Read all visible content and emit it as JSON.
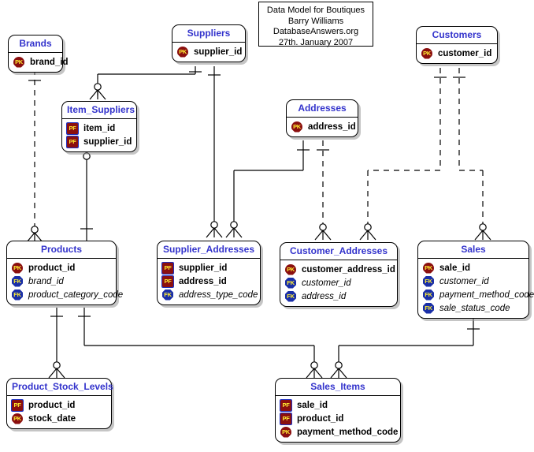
{
  "diagram": {
    "title_block": {
      "lines": [
        "Data Model for Boutiques",
        "Barry Williams",
        "DatabaseAnswers.org",
        "27th. January 2007"
      ]
    },
    "colors": {
      "entity_title": "#3333cc",
      "pk_badge": "#8b0f0f",
      "fk_badge": "#1a2fa8",
      "badge_text": "#ffee33",
      "line": "#000000",
      "background": "#ffffff"
    },
    "entities": [
      {
        "id": "brands",
        "name": "Brands",
        "attributes": [
          {
            "key": "PK",
            "name": "brand_id"
          }
        ]
      },
      {
        "id": "suppliers",
        "name": "Suppliers",
        "attributes": [
          {
            "key": "PK",
            "name": "supplier_id"
          }
        ]
      },
      {
        "id": "customers",
        "name": "Customers",
        "attributes": [
          {
            "key": "PK",
            "name": "customer_id"
          }
        ]
      },
      {
        "id": "item_suppliers",
        "name": "Item_Suppliers",
        "attributes": [
          {
            "key": "PF",
            "name": "item_id"
          },
          {
            "key": "PF",
            "name": "supplier_id"
          }
        ]
      },
      {
        "id": "addresses",
        "name": "Addresses",
        "attributes": [
          {
            "key": "PK",
            "name": "address_id"
          }
        ]
      },
      {
        "id": "products",
        "name": "Products",
        "attributes": [
          {
            "key": "PK",
            "name": "product_id"
          },
          {
            "key": "FK",
            "name": "brand_id"
          },
          {
            "key": "FK",
            "name": "product_category_code"
          }
        ]
      },
      {
        "id": "supplier_addresses",
        "name": "Supplier_Addresses",
        "attributes": [
          {
            "key": "PF",
            "name": "supplier_id"
          },
          {
            "key": "PF",
            "name": "address_id"
          },
          {
            "key": "FK",
            "name": "address_type_code"
          }
        ]
      },
      {
        "id": "customer_addresses",
        "name": "Customer_Addresses",
        "attributes": [
          {
            "key": "PK",
            "name": "customer_address_id"
          },
          {
            "key": "FK",
            "name": "customer_id"
          },
          {
            "key": "FK",
            "name": "address_id"
          }
        ]
      },
      {
        "id": "sales",
        "name": "Sales",
        "attributes": [
          {
            "key": "PK",
            "name": "sale_id"
          },
          {
            "key": "FK",
            "name": "customer_id"
          },
          {
            "key": "FK",
            "name": "payment_method_code"
          },
          {
            "key": "FK",
            "name": "sale_status_code"
          }
        ]
      },
      {
        "id": "product_stock_levels",
        "name": "Product_Stock_Levels",
        "attributes": [
          {
            "key": "PF",
            "name": "product_id"
          },
          {
            "key": "PK",
            "name": "stock_date"
          }
        ]
      },
      {
        "id": "sales_items",
        "name": "Sales_Items",
        "attributes": [
          {
            "key": "PF",
            "name": "sale_id"
          },
          {
            "key": "PF",
            "name": "product_id"
          },
          {
            "key": "PK",
            "name": "payment_method_code"
          }
        ]
      }
    ],
    "relationships": [
      {
        "from": "brands",
        "to": "products",
        "style": "dashed",
        "from_card": "one-mandatory",
        "to_card": "zero-or-many"
      },
      {
        "from": "suppliers",
        "to": "item_suppliers",
        "style": "solid",
        "from_card": "one-mandatory",
        "to_card": "zero-or-many"
      },
      {
        "from": "suppliers",
        "to": "supplier_addresses",
        "style": "solid",
        "from_card": "one-mandatory",
        "to_card": "zero-or-many"
      },
      {
        "from": "item_suppliers",
        "to": "products",
        "style": "solid",
        "from_card": "one-mandatory",
        "to_card": "zero-or-many"
      },
      {
        "from": "addresses",
        "to": "supplier_addresses",
        "style": "solid",
        "from_card": "one-mandatory",
        "to_card": "zero-or-many"
      },
      {
        "from": "addresses",
        "to": "customer_addresses",
        "style": "dashed",
        "from_card": "one-mandatory",
        "to_card": "zero-or-many"
      },
      {
        "from": "customers",
        "to": "customer_addresses",
        "style": "dashed",
        "from_card": "one-mandatory",
        "to_card": "zero-or-many"
      },
      {
        "from": "customers",
        "to": "sales",
        "style": "dashed",
        "from_card": "one-mandatory",
        "to_card": "zero-or-many"
      },
      {
        "from": "products",
        "to": "product_stock_levels",
        "style": "solid",
        "from_card": "one-mandatory",
        "to_card": "zero-or-many"
      },
      {
        "from": "products",
        "to": "sales_items",
        "style": "solid",
        "from_card": "one-mandatory",
        "to_card": "zero-or-many"
      },
      {
        "from": "sales",
        "to": "sales_items",
        "style": "solid",
        "from_card": "one-mandatory",
        "to_card": "zero-or-many"
      }
    ]
  }
}
